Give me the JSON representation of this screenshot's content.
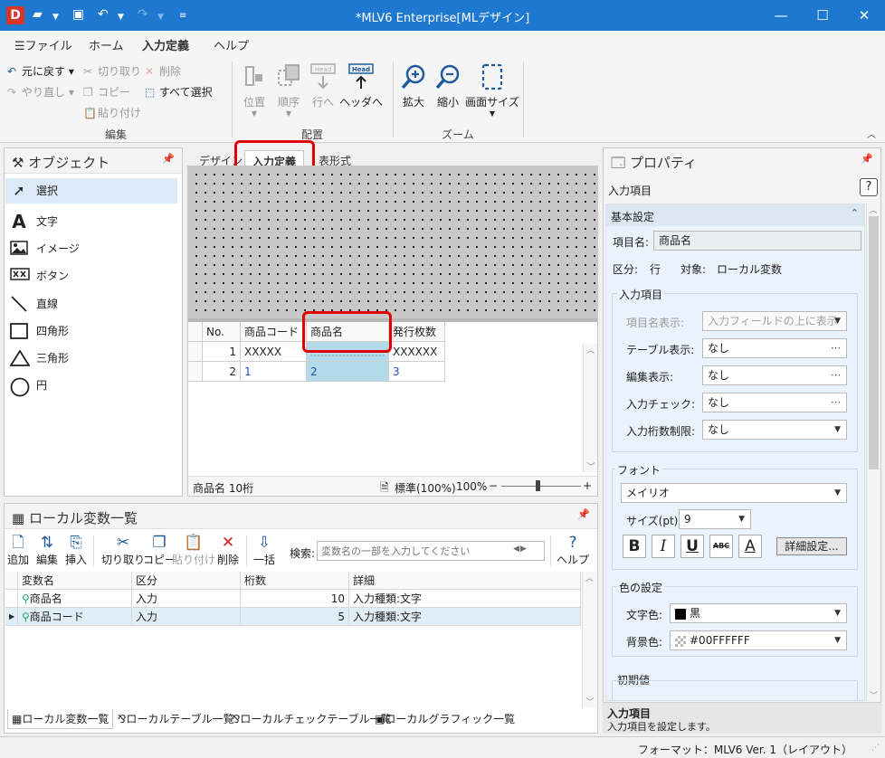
{
  "window": {
    "title": "*MLV6 Enterprise[MLデザイン]",
    "logo": "D",
    "controls": [
      "—",
      "☐",
      "✕"
    ]
  },
  "menu": {
    "file": "ファイル",
    "tabs": [
      "ホーム",
      "入力定義",
      "ヘルプ"
    ],
    "active_index": 1
  },
  "ribbon": {
    "edit": {
      "undo": "元に戻す",
      "redo": "やり直し",
      "cut": "切り取り",
      "copy": "コピー",
      "paste": "貼り付け",
      "delete": "削除",
      "select_all": "すべて選択",
      "group": "編集"
    },
    "layout": {
      "position": "位置",
      "order": "順序",
      "to_row": "行へ",
      "to_header": "ヘッダへ",
      "group": "配置",
      "head_icon_text": "Head"
    },
    "zoom": {
      "zoom_in": "拡大",
      "zoom_out": "縮小",
      "screen_size": "画面サイズ",
      "group": "ズーム"
    }
  },
  "objects_panel": {
    "title": "オブジェクト",
    "items": [
      {
        "label": "選択",
        "icon": "cursor-arrow-icon"
      },
      {
        "label": "文字",
        "icon": "text-a-icon"
      },
      {
        "label": "イメージ",
        "icon": "image-icon"
      },
      {
        "label": "ボタン",
        "icon": "button-xx-icon"
      },
      {
        "label": "直線",
        "icon": "line-icon"
      },
      {
        "label": "四角形",
        "icon": "rectangle-icon"
      },
      {
        "label": "三角形",
        "icon": "triangle-icon"
      },
      {
        "label": "円",
        "icon": "circle-icon"
      }
    ]
  },
  "designer": {
    "tabs": [
      "デザイン",
      "入力定義",
      "表形式"
    ],
    "active_index": 1,
    "grid": {
      "headers": [
        "No.",
        "商品コード",
        "商品名",
        "発行枚数"
      ],
      "rows": [
        [
          "1",
          "XXXXX",
          "",
          "XXXXXX"
        ],
        [
          "2",
          "1",
          "2",
          "3"
        ]
      ]
    },
    "status": {
      "field_info": "商品名  10桁",
      "zoom_mode": "標準(100%)",
      "zoom_percent": "100%",
      "minus": "−",
      "plus": "+"
    }
  },
  "variables_panel": {
    "title": "ローカル変数一覧",
    "toolbar": {
      "add": "追加",
      "edit": "編集",
      "insert": "挿入",
      "cut": "切り取り",
      "copy": "コピー",
      "paste": "貼り付け",
      "delete": "削除",
      "batch": "一括",
      "search_label": "検索:",
      "search_placeholder": "変数名の一部を入力してください",
      "help": "ヘルプ"
    },
    "columns": [
      "変数名",
      "区分",
      "桁数",
      "詳細"
    ],
    "rows": [
      {
        "name": "商品名",
        "kind": "入力",
        "digits": "10",
        "detail": "入力種類:文字"
      },
      {
        "name": "商品コード",
        "kind": "入力",
        "digits": "5",
        "detail": "入力種類:文字"
      }
    ],
    "bottom_tabs": [
      "ローカル変数一覧",
      "ローカルテーブル一覧",
      "ローカルチェックテーブル一覧",
      "ローカルグラフィック一覧"
    ]
  },
  "properties_panel": {
    "title": "プロパティ",
    "subtitle": "入力項目",
    "basic_section": "基本設定",
    "item_name_label": "項目名:",
    "item_name_value": "商品名",
    "kubun_label": "区分:",
    "kubun_value": "行",
    "target_label": "対象:",
    "target_value": "ローカル変数",
    "input_group": "入力項目",
    "fields": [
      {
        "label": "項目名表示:",
        "value": "入力フィールドの上に表示",
        "disabled": true,
        "control": "dropdown"
      },
      {
        "label": "テーブル表示:",
        "value": "なし",
        "control": "ellipsis"
      },
      {
        "label": "編集表示:",
        "value": "なし",
        "control": "ellipsis"
      },
      {
        "label": "入力チェック:",
        "value": "なし",
        "control": "ellipsis"
      },
      {
        "label": "入力桁数制限:",
        "value": "なし",
        "control": "dropdown"
      }
    ],
    "font_group": "フォント",
    "font_name": "メイリオ",
    "size_label": "サイズ(pt):",
    "size_value": "9",
    "style_buttons": [
      "B",
      "I",
      "U",
      "ABC",
      "A"
    ],
    "detail_button": "詳細設定...",
    "color_group": "色の設定",
    "fg_label": "文字色:",
    "fg_value": "黒",
    "fg_color": "#000000",
    "bg_label": "背景色:",
    "bg_value": "#00FFFFFF",
    "initial_group": "初期値",
    "footer_title": "入力項目",
    "footer_desc": "入力項目を設定します。"
  },
  "statusbar": {
    "text": "フォーマット：MLV6 Ver. 1（レイアウト）"
  },
  "colors": {
    "titlebar": "#1e78d0",
    "highlight": "#e00000",
    "selection": "#b3dbe9"
  }
}
